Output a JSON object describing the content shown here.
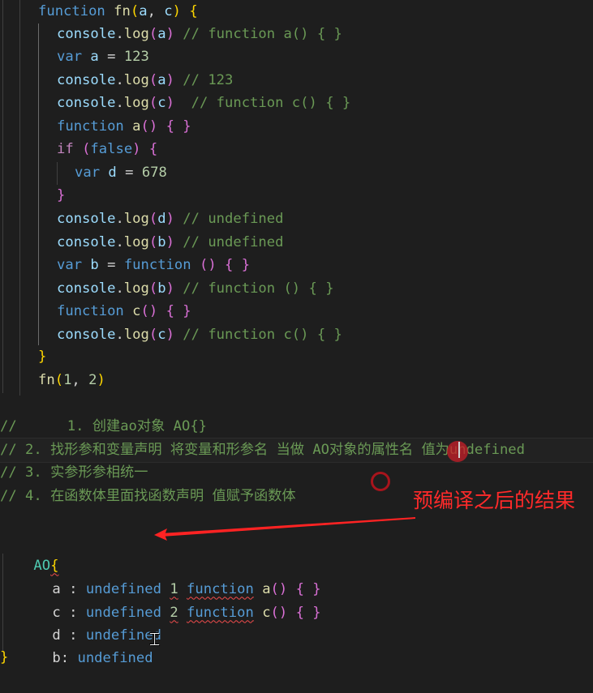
{
  "editor": {
    "code_lines": [
      {
        "tokens": [
          [
            "kw",
            "function"
          ],
          [
            "plain",
            " "
          ],
          [
            "fn",
            "fn"
          ],
          [
            "br1",
            "("
          ],
          [
            "var",
            "a"
          ],
          [
            "plain",
            ", "
          ],
          [
            "var",
            "c"
          ],
          [
            "br1",
            ")"
          ],
          [
            "plain",
            " "
          ],
          [
            "br1",
            "{"
          ]
        ]
      },
      {
        "tokens": [
          [
            "var",
            "console"
          ],
          [
            "plain",
            "."
          ],
          [
            "fn",
            "log"
          ],
          [
            "br2",
            "("
          ],
          [
            "var",
            "a"
          ],
          [
            "br2",
            ")"
          ],
          [
            "plain",
            " "
          ],
          [
            "cm",
            "// function a() { }"
          ]
        ]
      },
      {
        "tokens": [
          [
            "kw",
            "var"
          ],
          [
            "plain",
            " "
          ],
          [
            "var",
            "a"
          ],
          [
            "plain",
            " = "
          ],
          [
            "num",
            "123"
          ]
        ]
      },
      {
        "tokens": [
          [
            "var",
            "console"
          ],
          [
            "plain",
            "."
          ],
          [
            "fn",
            "log"
          ],
          [
            "br2",
            "("
          ],
          [
            "var",
            "a"
          ],
          [
            "br2",
            ")"
          ],
          [
            "plain",
            " "
          ],
          [
            "cm",
            "// 123"
          ]
        ]
      },
      {
        "tokens": [
          [
            "var",
            "console"
          ],
          [
            "plain",
            "."
          ],
          [
            "fn",
            "log"
          ],
          [
            "br2",
            "("
          ],
          [
            "var",
            "c"
          ],
          [
            "br2",
            ")"
          ],
          [
            "plain",
            "  "
          ],
          [
            "cm",
            "// function c() { }"
          ]
        ]
      },
      {
        "tokens": [
          [
            "kw",
            "function"
          ],
          [
            "plain",
            " "
          ],
          [
            "fn",
            "a"
          ],
          [
            "br2",
            "()"
          ],
          [
            "plain",
            " "
          ],
          [
            "br2",
            "{ }"
          ]
        ]
      },
      {
        "tokens": [
          [
            "ctl",
            "if"
          ],
          [
            "plain",
            " "
          ],
          [
            "br2",
            "("
          ],
          [
            "kw",
            "false"
          ],
          [
            "br2",
            ")"
          ],
          [
            "plain",
            " "
          ],
          [
            "br2",
            "{"
          ]
        ]
      },
      {
        "tokens": [
          [
            "kw",
            "var"
          ],
          [
            "plain",
            " "
          ],
          [
            "var",
            "d"
          ],
          [
            "plain",
            " = "
          ],
          [
            "num",
            "678"
          ]
        ]
      },
      {
        "tokens": [
          [
            "br2",
            "}"
          ]
        ]
      },
      {
        "tokens": [
          [
            "var",
            "console"
          ],
          [
            "plain",
            "."
          ],
          [
            "fn",
            "log"
          ],
          [
            "br2",
            "("
          ],
          [
            "var",
            "d"
          ],
          [
            "br2",
            ")"
          ],
          [
            "plain",
            " "
          ],
          [
            "cm",
            "// undefined"
          ]
        ]
      },
      {
        "tokens": [
          [
            "var",
            "console"
          ],
          [
            "plain",
            "."
          ],
          [
            "fn",
            "log"
          ],
          [
            "br2",
            "("
          ],
          [
            "var",
            "b"
          ],
          [
            "br2",
            ")"
          ],
          [
            "plain",
            " "
          ],
          [
            "cm",
            "// undefined"
          ]
        ]
      },
      {
        "tokens": [
          [
            "kw",
            "var"
          ],
          [
            "plain",
            " "
          ],
          [
            "var",
            "b"
          ],
          [
            "plain",
            " = "
          ],
          [
            "kw",
            "function"
          ],
          [
            "plain",
            " "
          ],
          [
            "br2",
            "()"
          ],
          [
            "plain",
            " "
          ],
          [
            "br2",
            "{ }"
          ]
        ]
      },
      {
        "tokens": [
          [
            "var",
            "console"
          ],
          [
            "plain",
            "."
          ],
          [
            "fn",
            "log"
          ],
          [
            "br2",
            "("
          ],
          [
            "var",
            "b"
          ],
          [
            "br2",
            ")"
          ],
          [
            "plain",
            " "
          ],
          [
            "cm",
            "// function () { }"
          ]
        ]
      },
      {
        "tokens": [
          [
            "kw",
            "function"
          ],
          [
            "plain",
            " "
          ],
          [
            "fn",
            "c"
          ],
          [
            "br2",
            "()"
          ],
          [
            "plain",
            " "
          ],
          [
            "br2",
            "{ }"
          ]
        ]
      },
      {
        "tokens": [
          [
            "var",
            "console"
          ],
          [
            "plain",
            "."
          ],
          [
            "fn",
            "log"
          ],
          [
            "br2",
            "("
          ],
          [
            "var",
            "c"
          ],
          [
            "br2",
            ")"
          ],
          [
            "plain",
            " "
          ],
          [
            "cm",
            "// function c() { }"
          ]
        ]
      },
      {
        "tokens": [
          [
            "br1",
            "}"
          ]
        ]
      },
      {
        "tokens": [
          [
            "fn",
            "fn"
          ],
          [
            "br1",
            "("
          ],
          [
            "num",
            "1"
          ],
          [
            "plain",
            ", "
          ],
          [
            "num",
            "2"
          ],
          [
            "br1",
            ")"
          ]
        ]
      }
    ],
    "comment_lines": [
      "//      1. 创建ao对象 AO{}",
      "// 2. 找形参和变量声明 将变量和形参名 当做 AO对象的属性名 值为undefined",
      "// 3. 实参形参相统一",
      "// 4. 在函数体里面找函数声明 值赋予函数体"
    ],
    "ao_block": {
      "open": {
        "name": "AO",
        "brace": "{"
      },
      "rows": [
        {
          "key": "a",
          "sep": " : ",
          "value": "undefined",
          "arg": "1",
          "fn_kw": "function",
          "fn_name": "a",
          "fn_rest_paren": "()",
          "fn_rest_body": "{ }"
        },
        {
          "key": "c",
          "sep": " : ",
          "value": "undefined",
          "arg": "2",
          "fn_kw": "function",
          "fn_name": "c",
          "fn_rest_paren": "()",
          "fn_rest_body": "{ }"
        },
        {
          "key": "d",
          "sep": " : ",
          "value": "undefined"
        },
        {
          "key": "b",
          "sep": ": ",
          "value": "undefined"
        }
      ],
      "close": "}"
    }
  },
  "annotation": {
    "label": "预编译之后的结果",
    "color": "#ff2a2a"
  }
}
